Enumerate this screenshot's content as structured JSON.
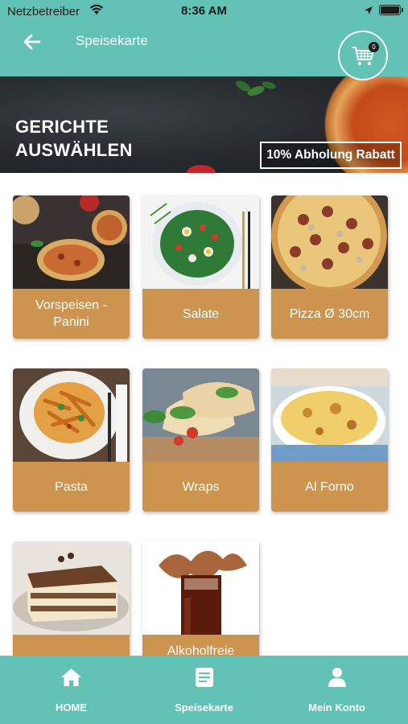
{
  "status_bar": {
    "carrier": "Netzbetreiber",
    "time": "8:36 AM"
  },
  "header": {
    "title": "Speisekarte",
    "cart_count": "0"
  },
  "banner": {
    "headline_line1": "GERICHTE",
    "headline_line2": "AUSWÄHLEN",
    "promo": "10% Abholung Rabatt"
  },
  "categories": [
    {
      "label": "Vorspeisen - Panini"
    },
    {
      "label": "Salate"
    },
    {
      "label": "Pizza Ø 30cm"
    },
    {
      "label": "Pasta"
    },
    {
      "label": "Wraps"
    },
    {
      "label": "Al Forno"
    },
    {
      "label": ""
    },
    {
      "label": "Alkoholfreie"
    }
  ],
  "bottom_nav": [
    {
      "label": "HOME",
      "icon": "home-icon"
    },
    {
      "label": "Speisekarte",
      "icon": "menu-list-icon"
    },
    {
      "label": "Mein Konto",
      "icon": "user-icon"
    }
  ],
  "colors": {
    "teal": "#62c2b5",
    "card_label": "#cd9450",
    "banner_dark": "#262a2e"
  }
}
